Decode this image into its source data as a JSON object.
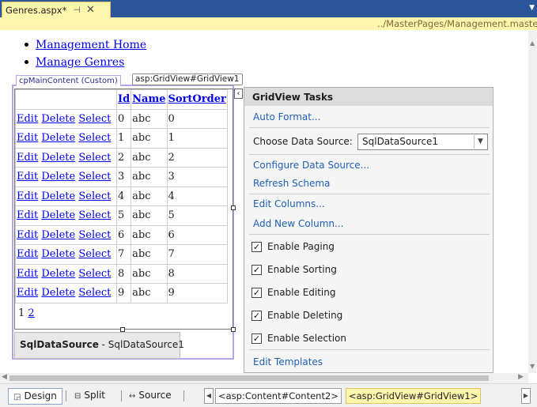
{
  "tab": {
    "title": "Genres.aspx*",
    "pin": "⊣",
    "close": "✕"
  },
  "master_path": "../MasterPages/Management.master",
  "nav_links": [
    "Management Home",
    "Manage Genres"
  ],
  "content_tag": "cpMainContent (Custom)",
  "gridview_tag": "asp:GridView#GridView1",
  "grid": {
    "headers": [
      "",
      "Id",
      "Name",
      "SortOrder"
    ],
    "row_actions": [
      "Edit",
      "Delete",
      "Select"
    ],
    "rows": [
      {
        "id": "0",
        "name": "abc",
        "sort": "0"
      },
      {
        "id": "1",
        "name": "abc",
        "sort": "1"
      },
      {
        "id": "2",
        "name": "abc",
        "sort": "2"
      },
      {
        "id": "3",
        "name": "abc",
        "sort": "3"
      },
      {
        "id": "4",
        "name": "abc",
        "sort": "4"
      },
      {
        "id": "5",
        "name": "abc",
        "sort": "5"
      },
      {
        "id": "6",
        "name": "abc",
        "sort": "6"
      },
      {
        "id": "7",
        "name": "abc",
        "sort": "7"
      },
      {
        "id": "8",
        "name": "abc",
        "sort": "8"
      },
      {
        "id": "9",
        "name": "abc",
        "sort": "9"
      }
    ],
    "pager": {
      "current": "1",
      "next": "2"
    }
  },
  "sqldatasource": {
    "type": "SqlDataSource",
    "name": " - SqlDataSource1"
  },
  "tasks": {
    "title": "GridView Tasks",
    "auto_format": "Auto Format...",
    "choose_ds_label": "Choose Data Source:",
    "choose_ds_value": "SqlDataSource1",
    "configure_ds": "Configure Data Source...",
    "refresh_schema": "Refresh Schema",
    "edit_columns": "Edit Columns...",
    "add_column": "Add New Column...",
    "options": [
      {
        "label": "Enable Paging",
        "checked": true
      },
      {
        "label": "Enable Sorting",
        "checked": true
      },
      {
        "label": "Enable Editing",
        "checked": true
      },
      {
        "label": "Enable Deleting",
        "checked": true
      },
      {
        "label": "Enable Selection",
        "checked": true
      }
    ],
    "edit_templates": "Edit Templates"
  },
  "view_buttons": {
    "design": "Design",
    "split": "Split",
    "source": "Source"
  },
  "breadcrumbs": [
    "<asp:Content#Content2>",
    "<asp:GridView#GridView1>"
  ],
  "colors": {
    "accent_bar": "#2b579a",
    "tab_active": "#fff6ad",
    "link": "#0000ee",
    "task_link": "#1e5fb4"
  }
}
